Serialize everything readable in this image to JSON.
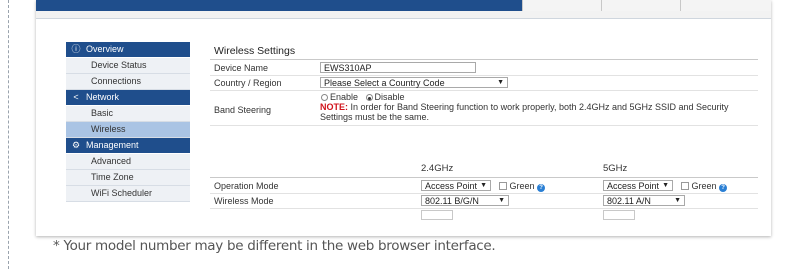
{
  "sidebar": {
    "sections": [
      {
        "label": "Overview",
        "icon": "info-icon",
        "items": [
          "Device Status",
          "Connections"
        ]
      },
      {
        "label": "Network",
        "icon": "share-icon",
        "items": [
          "Basic",
          "Wireless"
        ]
      },
      {
        "label": "Management",
        "icon": "gear-icon",
        "items": [
          "Advanced",
          "Time Zone",
          "WiFi Scheduler"
        ]
      }
    ],
    "active_item": "Wireless"
  },
  "content": {
    "title": "Wireless Settings",
    "device_name_label": "Device Name",
    "device_name_value": "EWS310AP",
    "country_label": "Country / Region",
    "country_value": "Please Select a Country Code",
    "band_steering_label": "Band Steering",
    "enable_label": "Enable",
    "disable_label": "Disable",
    "band_steering_selected": "Disable",
    "note_label": "NOTE:",
    "note_text_1": " In order for Band Steering function to work properly, both 2.4GHz and 5GHz SSID and Security",
    "note_text_2": "Settings must be the same.",
    "col_24": "2.4GHz",
    "col_5": "5GHz",
    "operation_mode_label": "Operation Mode",
    "operation_mode_24": "Access Point",
    "operation_mode_5": "Access Point",
    "green_label": "Green",
    "wireless_mode_label": "Wireless Mode",
    "wireless_mode_24": "802.11 B/G/N",
    "wireless_mode_5": "802.11 A/N"
  },
  "footnote": "* Your model number may be different in the web browser interface.",
  "colors": {
    "brand_blue": "#1f4e8c",
    "active_item": "#aac4e4",
    "note_red": "#d0121a"
  }
}
